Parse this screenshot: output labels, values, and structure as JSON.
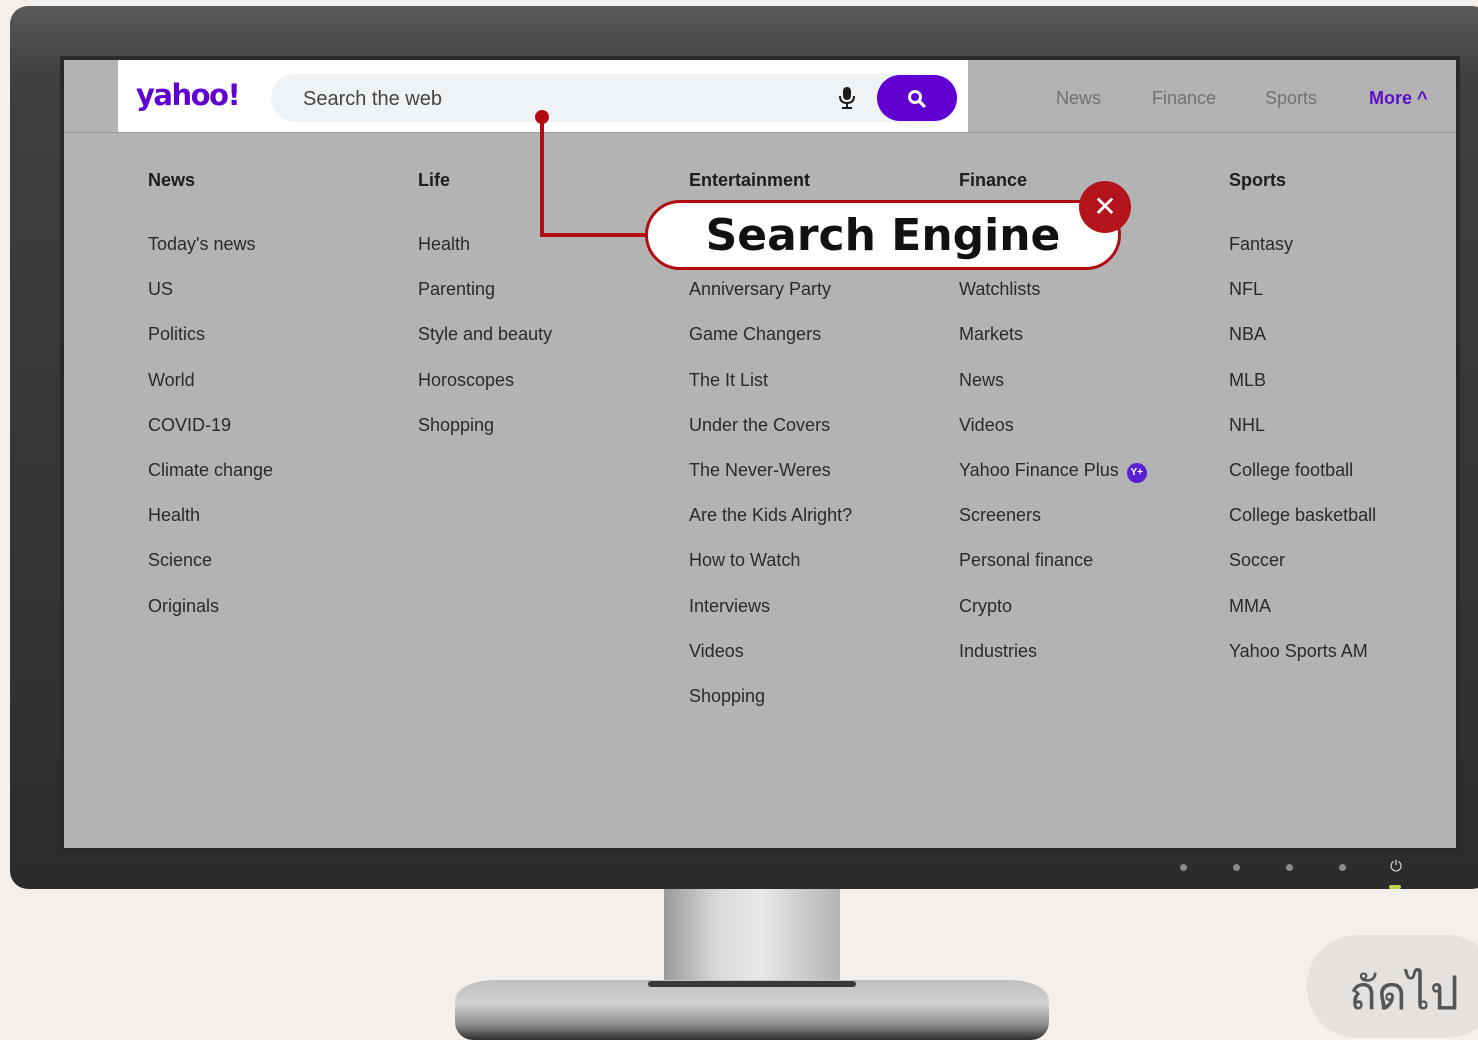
{
  "header": {
    "logo": "yahoo!",
    "search_placeholder": "Search the web",
    "nav": [
      "News",
      "Finance",
      "Sports",
      "More ^"
    ]
  },
  "menu": {
    "columns": [
      {
        "title": "News",
        "items": [
          "Today's news",
          "US",
          "Politics",
          "World",
          "COVID-19",
          "Climate change",
          "Health",
          "Science",
          "Originals"
        ]
      },
      {
        "title": "Life",
        "items": [
          "Health",
          "Parenting",
          "Style and beauty",
          "Horoscopes",
          "Shopping"
        ]
      },
      {
        "title": "Entertainment",
        "items": [
          "",
          "Anniversary Party",
          "Game Changers",
          "The It List",
          "Under the Covers",
          "The Never-Weres",
          "Are the Kids Alright?",
          "How to Watch",
          "Interviews",
          "Videos",
          "Shopping"
        ]
      },
      {
        "title": "Finance",
        "items": [
          "",
          "Watchlists",
          "Markets",
          "News",
          "Videos",
          "Yahoo Finance Plus",
          "Screeners",
          "Personal finance",
          "Crypto",
          "Industries"
        ]
      },
      {
        "title": "Sports",
        "items": [
          "Fantasy",
          "NFL",
          "NBA",
          "MLB",
          "NHL",
          "College football",
          "College basketball",
          "Soccer",
          "MMA",
          "Yahoo Sports AM"
        ]
      }
    ],
    "finance_plus_badge": "Y+"
  },
  "callout": {
    "label": "Search Engine",
    "close_symbol": "✕"
  },
  "next_button": "ถัดไป",
  "monitor": {
    "power_symbol": "⏻"
  },
  "colors": {
    "brand": "#6001d2",
    "callout_red": "#b00c12",
    "menu_bg": "#b3b3b3"
  }
}
